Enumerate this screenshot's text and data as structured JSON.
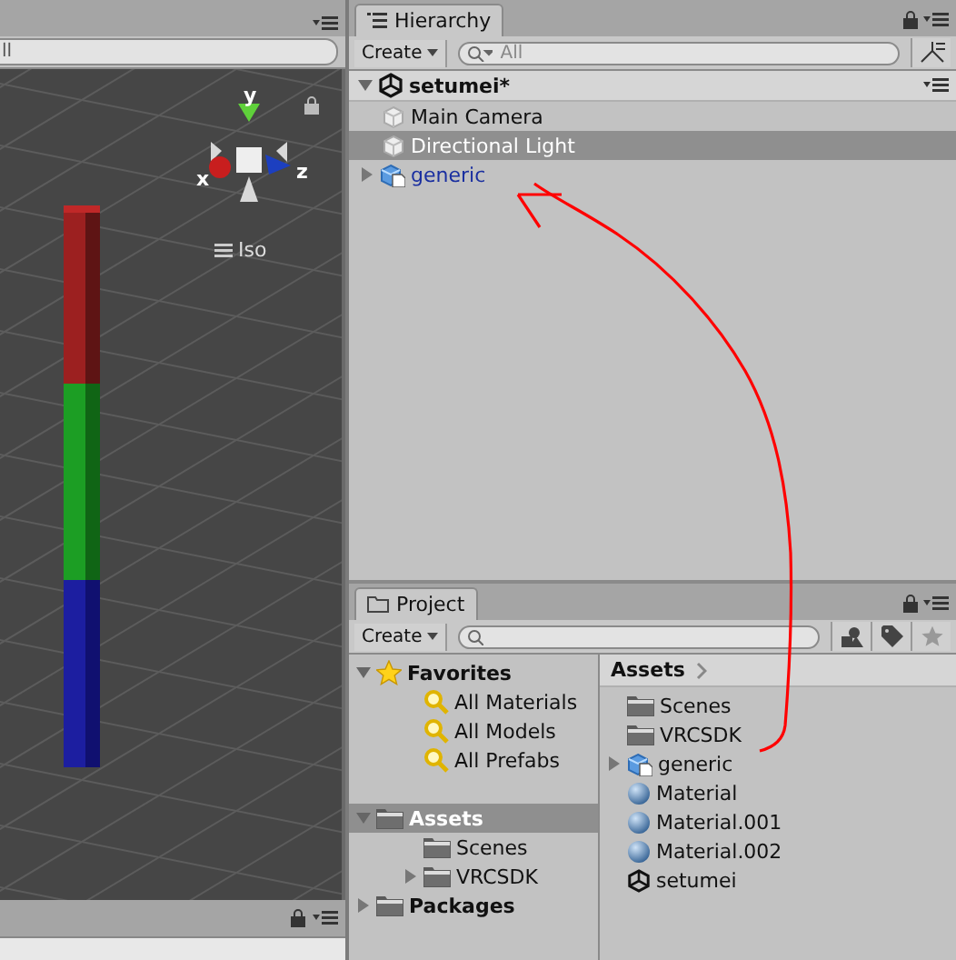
{
  "scene": {
    "search_value": "ll",
    "axes": [
      {
        "label": "y",
        "color": "#5fd03a"
      },
      {
        "label": "x",
        "color": "#c81e1e"
      },
      {
        "label": "z",
        "color": "#1c3fc0"
      }
    ],
    "projection": "Iso"
  },
  "hierarchy": {
    "tab": "Hierarchy",
    "create": "Create",
    "search_placeholder": "All",
    "scene": {
      "name": "setumei*",
      "expanded": true
    },
    "items": [
      {
        "name": "Main Camera",
        "kind": "object",
        "selected": false
      },
      {
        "name": "Directional Light",
        "kind": "object",
        "selected": true
      },
      {
        "name": "generic",
        "kind": "prefab",
        "expanded": false,
        "selected": false
      }
    ]
  },
  "project": {
    "tab": "Project",
    "create": "Create",
    "tree": [
      {
        "label": "Favorites",
        "kind": "favorites",
        "expanded": true,
        "selected": false,
        "children": [
          {
            "label": "All Materials",
            "kind": "search",
            "selected": false
          },
          {
            "label": "All Models",
            "kind": "search",
            "selected": false
          },
          {
            "label": "All Prefabs",
            "kind": "search",
            "selected": false
          }
        ]
      },
      {
        "label": "Assets",
        "kind": "folder",
        "expanded": true,
        "selected": true,
        "children": [
          {
            "label": "Scenes",
            "kind": "folder",
            "selected": false
          },
          {
            "label": "VRCSDK",
            "kind": "folder",
            "expanded": false,
            "selected": false
          }
        ]
      },
      {
        "label": "Packages",
        "kind": "folder",
        "expanded": false,
        "selected": false
      }
    ],
    "breadcrumb": "Assets",
    "assets": [
      {
        "name": "Scenes",
        "kind": "folder"
      },
      {
        "name": "VRCSDK",
        "kind": "folder"
      },
      {
        "name": "generic",
        "kind": "prefab",
        "expanded": false
      },
      {
        "name": "Material",
        "kind": "material"
      },
      {
        "name": "Material.001",
        "kind": "material"
      },
      {
        "name": "Material.002",
        "kind": "material"
      },
      {
        "name": "setumei",
        "kind": "scene"
      }
    ]
  }
}
